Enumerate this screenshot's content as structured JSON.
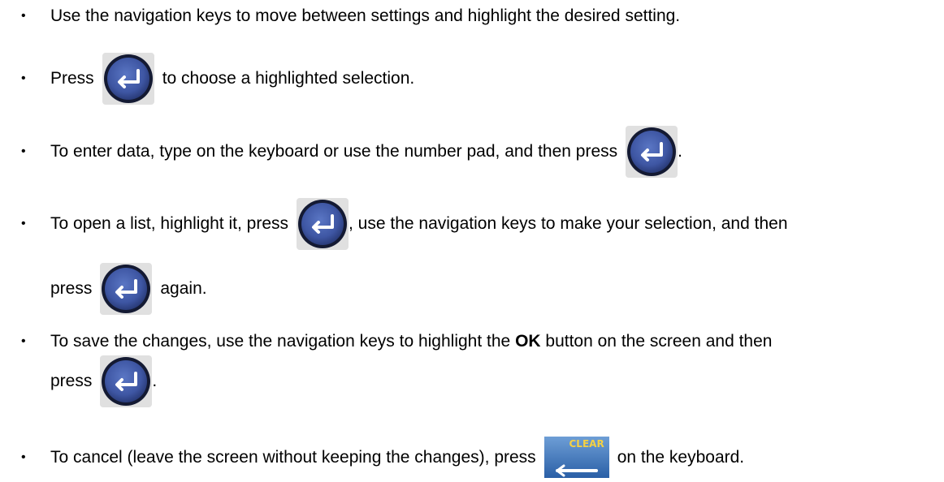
{
  "bullet": "•",
  "items": [
    {
      "text": "Use the navigation keys to move between settings and highlight the desired setting."
    },
    {
      "before": "Press",
      "after": "to choose a highlighted selection."
    },
    {
      "before": "To enter data, type on the keyboard or use the number pad, and then press",
      "after": "."
    },
    {
      "before": "To open a list, highlight it, press",
      "after": ", use the navigation keys to make your selection, and then",
      "line2_before": "press",
      "line2_after": "again."
    },
    {
      "line1_before": "To save the changes, use the navigation keys to highlight the",
      "line1_bold": "OK",
      "line1_after": "button on the screen and then",
      "line2_before": "press",
      "line2_after": "."
    },
    {
      "before": "To cancel (leave the screen without keeping the changes), press",
      "after": "on the keyboard."
    }
  ],
  "keys": {
    "enter_icon": "enter-key-icon",
    "clear_icon": "clear-key-icon",
    "clear_label": "CLEAR"
  },
  "colors": {
    "enter_outer": "#1a1f3a",
    "enter_inner": "#3f5aa8",
    "enter_arrow": "#ffffff",
    "enter_bg": "#d9d9d9",
    "clear_top": "#5d8fc9",
    "clear_bottom": "#2c64aa",
    "clear_label": "#f5d142"
  }
}
